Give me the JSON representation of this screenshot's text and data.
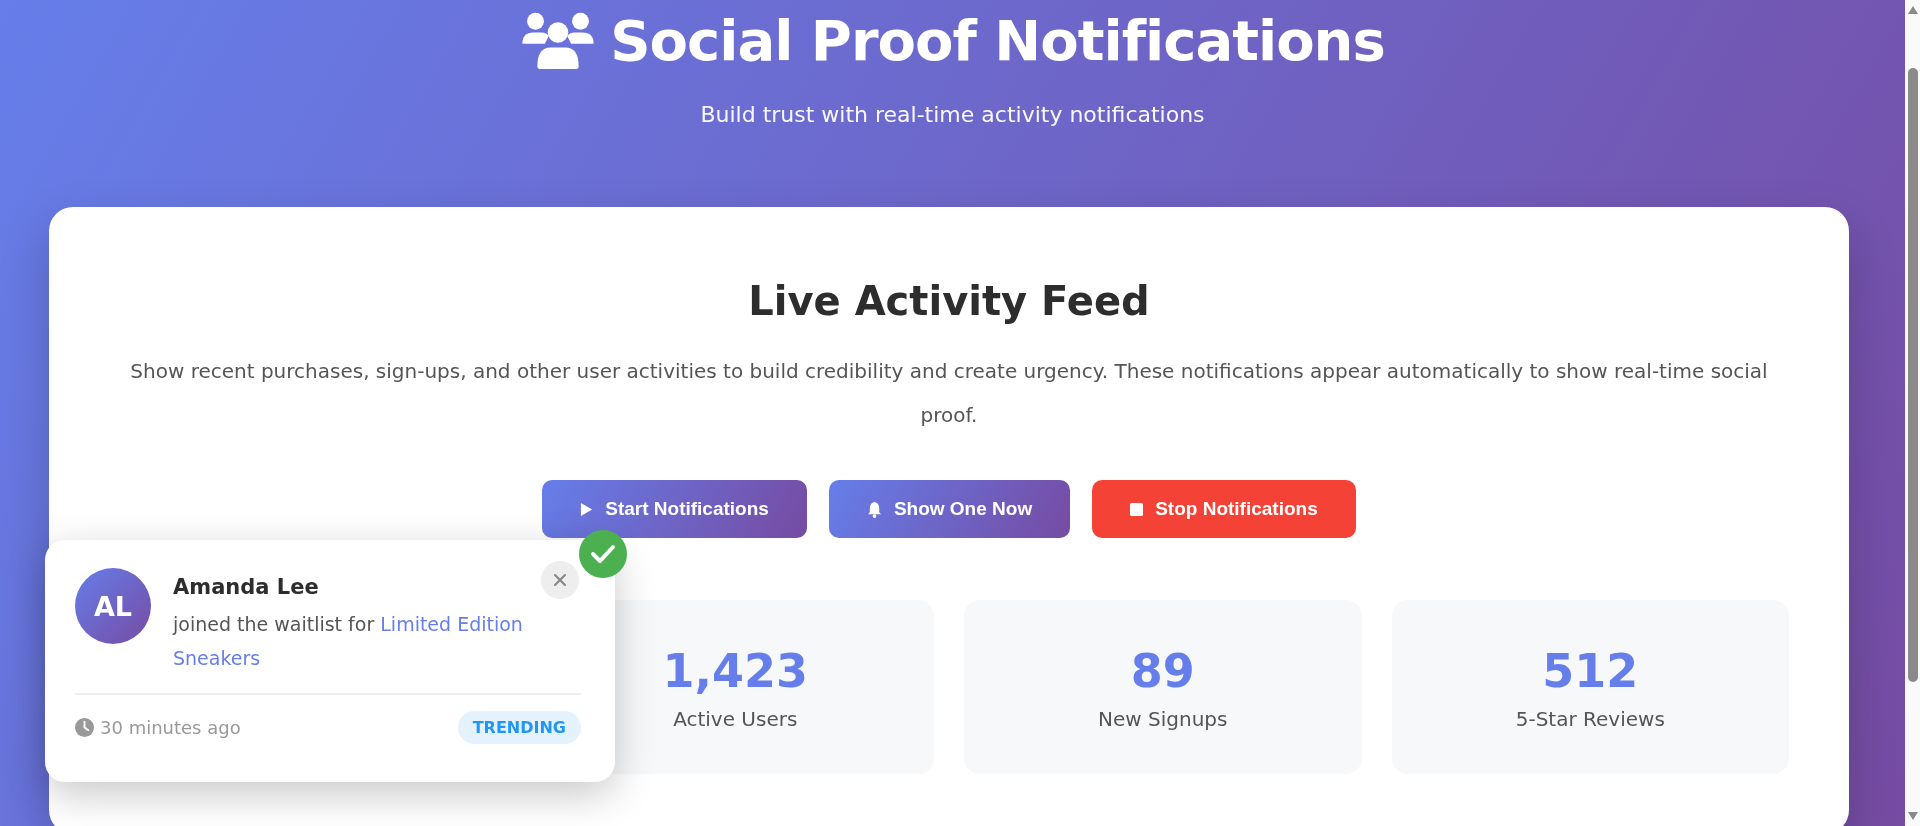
{
  "header": {
    "title": "Social Proof Notifications",
    "subtitle": "Build trust with real-time activity notifications"
  },
  "feed": {
    "title": "Live Activity Feed",
    "description": "Show recent purchases, sign-ups, and other user activities to build credibility and create urgency. These notifications appear automatically to show real-time social proof.",
    "buttons": [
      {
        "label": "Start Notifications",
        "kind": "start"
      },
      {
        "label": "Show One Now",
        "kind": "show"
      },
      {
        "label": "Stop Notifications",
        "kind": "stop"
      }
    ],
    "stats": [
      {
        "value": "1,423",
        "label": "Active Users"
      },
      {
        "value": "89",
        "label": "New Signups"
      },
      {
        "value": "512",
        "label": "5-Star Reviews"
      }
    ]
  },
  "notification": {
    "initials": "AL",
    "name": "Amanda Lee",
    "message": "joined the waitlist for",
    "product": "Limited Edition Sneakers",
    "time": "30 minutes ago",
    "badge": "TRENDING",
    "verified": true
  }
}
